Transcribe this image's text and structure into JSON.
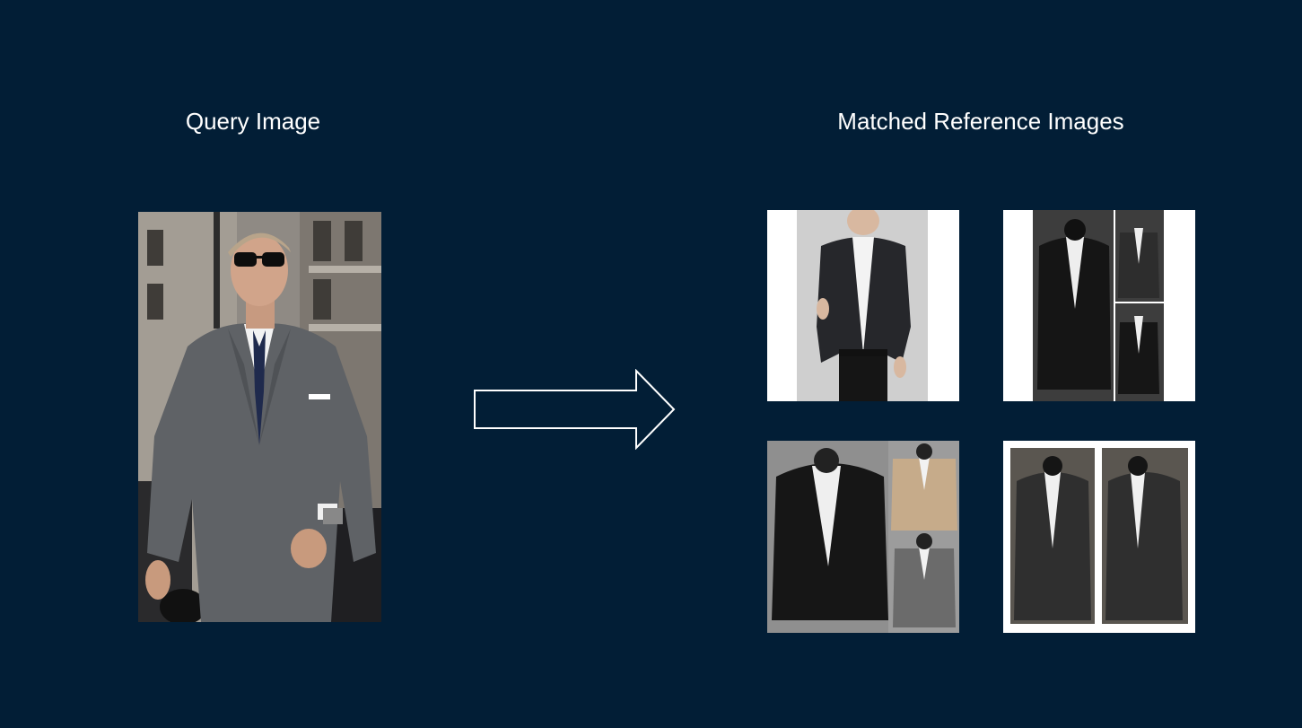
{
  "colors": {
    "background": "#021e36",
    "text": "#ffffff",
    "arrow_stroke": "#ffffff"
  },
  "query": {
    "title": "Query Image",
    "image": "man-in-grey-suit-photo"
  },
  "arrow": {
    "icon": "right-arrow-icon"
  },
  "references": {
    "title": "Matched Reference Images",
    "images": [
      "dark-blazer-on-model-photo",
      "black-cardigan-jacket-collage",
      "black-beige-grey-blazers-collage",
      "charcoal-cardigan-front-side-photo"
    ]
  }
}
